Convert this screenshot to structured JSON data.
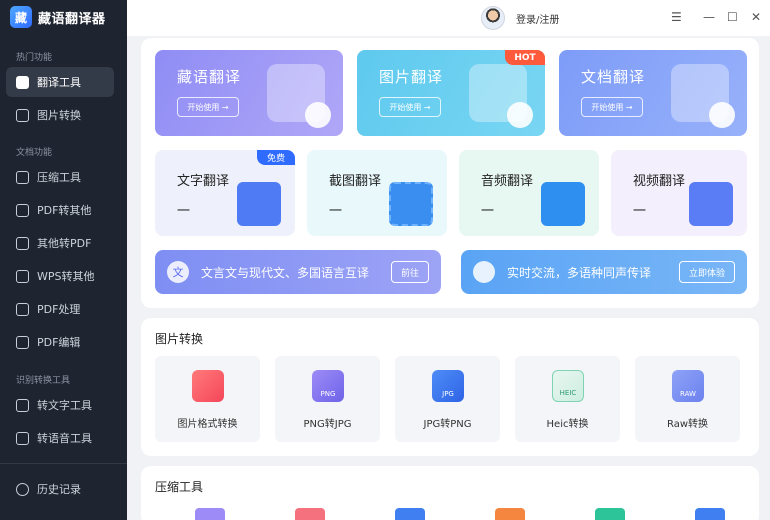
{
  "app": {
    "name": "藏语翻译器",
    "logo_text": "藏"
  },
  "sidebar": {
    "sections": [
      {
        "label": "热门功能",
        "items": [
          {
            "label": "翻译工具",
            "active": true
          },
          {
            "label": "图片转换",
            "active": false
          }
        ]
      },
      {
        "label": "文档功能",
        "items": [
          {
            "label": "压缩工具",
            "active": false
          },
          {
            "label": "PDF转其他",
            "active": false
          },
          {
            "label": "其他转PDF",
            "active": false
          },
          {
            "label": "WPS转其他",
            "active": false
          },
          {
            "label": "PDF处理",
            "active": false
          },
          {
            "label": "PDF编辑",
            "active": false
          }
        ]
      },
      {
        "label": "识别转换工具",
        "items": [
          {
            "label": "转文字工具",
            "active": false
          },
          {
            "label": "转语音工具",
            "active": false
          }
        ]
      }
    ],
    "history": "历史记录"
  },
  "topbar": {
    "login": "登录/注册",
    "menu": "☰",
    "minimize": "—",
    "maximize": "☐",
    "close": "✕"
  },
  "hero_cards": [
    {
      "title": "藏语翻译",
      "button": "开始使用 →",
      "badge": ""
    },
    {
      "title": "图片翻译",
      "button": "开始使用 →",
      "badge": "HOT"
    },
    {
      "title": "文档翻译",
      "button": "开始使用 →",
      "badge": ""
    }
  ],
  "small_cards": [
    {
      "title": "文字翻译",
      "dash": "一",
      "badge": "免费"
    },
    {
      "title": "截图翻译",
      "dash": "一",
      "badge": ""
    },
    {
      "title": "音频翻译",
      "dash": "一",
      "badge": ""
    },
    {
      "title": "视频翻译",
      "dash": "一",
      "badge": ""
    }
  ],
  "banners": [
    {
      "icon": "文",
      "text": "文言文与现代文、多国语言互译",
      "button": "前往"
    },
    {
      "icon": "",
      "text": "实时交流，多语种同声传译",
      "button": "立即体验"
    }
  ],
  "image_section": {
    "title": "图片转换",
    "tools": [
      {
        "label": "图片格式转换",
        "tag": ""
      },
      {
        "label": "PNG转JPG",
        "tag": "PNG"
      },
      {
        "label": "JPG转PNG",
        "tag": "JPG"
      },
      {
        "label": "Heic转换",
        "tag": "HEIC"
      },
      {
        "label": "Raw转换",
        "tag": "RAW"
      }
    ]
  },
  "compress_section": {
    "title": "压缩工具"
  },
  "colors": {
    "sidebar_bg": "#1f2530",
    "accent_blue": "#2f6bff",
    "hot_badge": "#ff5a3c"
  }
}
